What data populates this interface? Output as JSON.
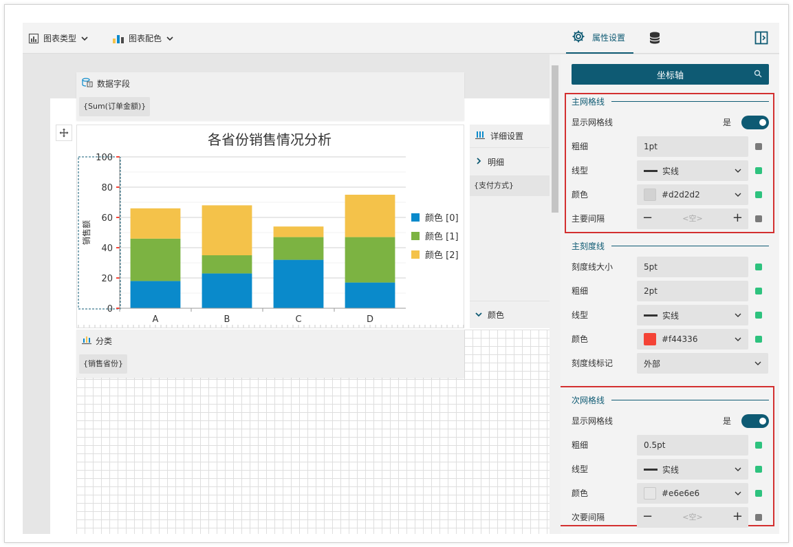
{
  "toolbar": {
    "chart_type_label": "图表类型",
    "chart_color_label": "图表配色",
    "property_tab_label": "属性设置"
  },
  "canvas": {
    "data_field_title": "数据字段",
    "data_field_chip": "{Sum(订单金额)}",
    "category_title": "分类",
    "category_chip": "{销售省份}",
    "detail_title": "详细设置",
    "detail_item": "明细",
    "detail_chip": "{支付方式}",
    "color_item": "颜色"
  },
  "chart_data": {
    "type": "bar",
    "stacked": true,
    "title": "各省份销售情况分析",
    "ylabel": "销售额",
    "xlabel": "",
    "categories": [
      "A",
      "B",
      "C",
      "D"
    ],
    "ylim": [
      0,
      100
    ],
    "yticks": [
      "0",
      "20",
      "40",
      "60",
      "80",
      "100"
    ],
    "series": [
      {
        "name": "颜色 [0]",
        "values": [
          18,
          23,
          32,
          17
        ],
        "color": "#0a8acb"
      },
      {
        "name": "颜色 [1]",
        "values": [
          28,
          12,
          15,
          30
        ],
        "color": "#7cb342"
      },
      {
        "name": "颜色 [2]",
        "values": [
          20,
          33,
          7,
          28
        ],
        "color": "#f4c24a"
      }
    ],
    "legend_position": "right",
    "grid": true
  },
  "props": {
    "search_label": "坐标轴",
    "major_grid": {
      "title": "主网格线",
      "show_label": "显示网格线",
      "show_value": "是",
      "width_label": "粗细",
      "width_value": "1pt",
      "style_label": "线型",
      "style_value": "实线",
      "color_label": "颜色",
      "color_value": "#d2d2d2",
      "interval_label": "主要间隔",
      "interval_placeholder": "<空>"
    },
    "major_tick": {
      "title": "主刻度线",
      "size_label": "刻度线大小",
      "size_value": "5pt",
      "width_label": "粗细",
      "width_value": "2pt",
      "style_label": "线型",
      "style_value": "实线",
      "color_label": "颜色",
      "color_value": "#f44336",
      "mark_label": "刻度线标记",
      "mark_value": "外部"
    },
    "minor_grid": {
      "title": "次网格线",
      "show_label": "显示网格线",
      "show_value": "是",
      "width_label": "粗细",
      "width_value": "0.5pt",
      "style_label": "线型",
      "style_value": "实线",
      "color_label": "颜色",
      "color_value": "#e6e6e6",
      "interval_label": "次要间隔",
      "interval_placeholder": "<空>"
    }
  },
  "colors": {
    "accent": "#0e5a73",
    "highlight": "#d32f2f",
    "status_on": "#2ec27e",
    "status_off": "#7a7a7a"
  }
}
